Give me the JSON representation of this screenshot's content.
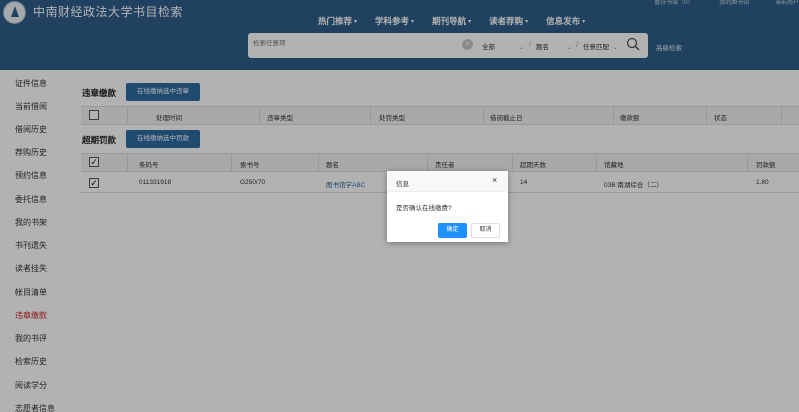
{
  "header": {
    "site_title": "中南财经政法大学书目检索",
    "top_links": [
      "暂存书架（0）",
      "我的图书馆",
      "当前用户"
    ],
    "nav": [
      "热门推荐",
      "学科参考",
      "期刊导航",
      "读者荐购",
      "信息发布"
    ],
    "search": {
      "placeholder": "检索任意项",
      "scope": "全部",
      "field": "题名",
      "match": "任意匹配",
      "advanced_label": "高级检索"
    }
  },
  "sidebar": {
    "items": [
      "证件信息",
      "当前借阅",
      "借阅历史",
      "荐购历史",
      "预约信息",
      "委托信息",
      "我的书架",
      "书刊遗失",
      "读者挂失",
      "帐目清单",
      "违章缴款",
      "我的书评",
      "检索历史",
      "阅读学分",
      "志愿者信息"
    ],
    "active": "违章缴款"
  },
  "violations": {
    "title": "违章缴款",
    "button": "在线缴纳选中违章",
    "columns": [
      "处理时间",
      "违章类型",
      "处罚类型",
      "借阅截止日",
      "缴款额",
      "状态"
    ]
  },
  "overdue": {
    "title": "超期罚款",
    "button": "在线缴纳选中罚款",
    "columns": [
      "条码号",
      "索书号",
      "题名",
      "责任者",
      "超期天数",
      "馆藏地",
      "罚款额"
    ],
    "rows": [
      {
        "checked": true,
        "barcode": "011331918",
        "call_no": "G250/70",
        "title": "图书馆学ABC",
        "author": "",
        "days": "14",
        "location": "03B:南湖综合（二）",
        "amount": "1.80"
      }
    ]
  },
  "dialog": {
    "title": "信息",
    "message": "是否确认在线缴费?",
    "ok": "确定",
    "cancel": "取消"
  },
  "colors": {
    "header_bg": "#2f5f8a",
    "button_bg": "#2f6ca3",
    "active_sidebar": "#cc2222",
    "dialog_ok": "#1e90ff"
  }
}
